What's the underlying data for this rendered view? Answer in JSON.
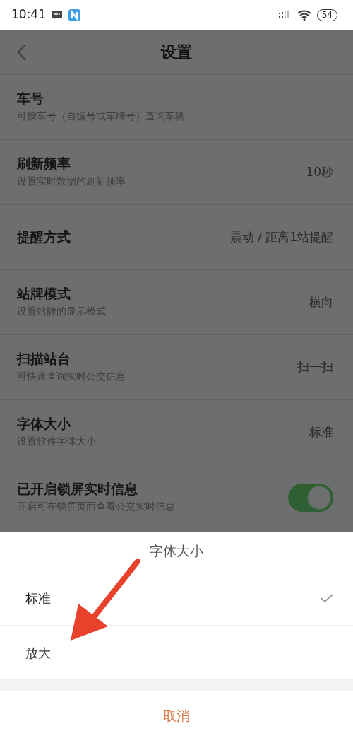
{
  "status_bar": {
    "time": "10:41",
    "battery": "54"
  },
  "header": {
    "title": "设置"
  },
  "settings": [
    {
      "kind": "value",
      "title": "车号",
      "subtitle": "可按车号（自编号或车牌号）查询车辆"
    },
    {
      "kind": "value",
      "title": "刷新频率",
      "subtitle": "设置实时数据的刷新频率",
      "value": "10秒"
    },
    {
      "kind": "value",
      "title": "提醒方式",
      "value": "震动 / 距离1站提醒"
    },
    {
      "kind": "value",
      "title": "站牌模式",
      "subtitle": "设置站牌的显示模式",
      "value": "横向"
    },
    {
      "kind": "value",
      "title": "扫描站台",
      "subtitle": "可快速查询实时公交信息",
      "value": "扫一扫"
    },
    {
      "kind": "value",
      "title": "字体大小",
      "subtitle": "设置软件字体大小",
      "value": "标准"
    },
    {
      "kind": "toggle",
      "title": "已开启锁屏实时信息",
      "subtitle": "开启可在锁屏页面查看公交实时信息",
      "on": true
    }
  ],
  "sheet": {
    "title": "字体大小",
    "options": [
      {
        "label": "标准",
        "selected": true
      },
      {
        "label": "放大",
        "selected": false
      }
    ],
    "cancel": "取消"
  }
}
